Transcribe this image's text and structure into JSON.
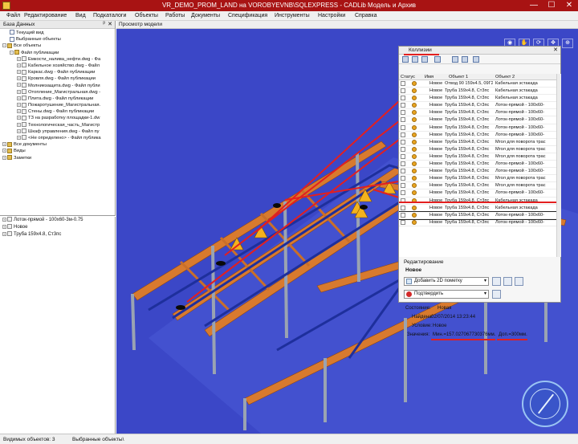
{
  "window": {
    "title": "VR_DEMO_PROM_LAND на VOROBYEVNB\\SQLEXPRESS - CADLib Модель и Архив",
    "min": "—",
    "max": "☐",
    "close": "✕"
  },
  "menu": [
    "Файл",
    "Редактирование",
    "Вид",
    "Подкаталоги",
    "Объекты",
    "Работы",
    "Документы",
    "Спецификация",
    "Инструменты",
    "Настройки",
    "Справка"
  ],
  "db_panel": {
    "title": "База Данных",
    "pin": "ᵖ",
    "close": "✕",
    "items": [
      {
        "label": "Текущий вид",
        "indent": 1,
        "icon": "doc"
      },
      {
        "label": "Выбранные объекты",
        "indent": 1,
        "icon": "doc"
      },
      {
        "label": "Все объекты",
        "indent": 0,
        "icon": "folder",
        "expander": "−"
      },
      {
        "label": "Файл публикации",
        "indent": 1,
        "icon": "folder",
        "expander": "−"
      },
      {
        "label": "Емкости_налива_нефти.dwg - Фа",
        "indent": 2,
        "icon": "file",
        "expander": "+"
      },
      {
        "label": "Кабельное хозяйство.dwg - Файл",
        "indent": 2,
        "icon": "file",
        "expander": "+"
      },
      {
        "label": "Каркас.dwg - Файл публикации",
        "indent": 2,
        "icon": "file",
        "expander": "+"
      },
      {
        "label": "Кровля.dwg - Файл публикации",
        "indent": 2,
        "icon": "file",
        "expander": "+"
      },
      {
        "label": "Молниезащита.dwg - Файл публи",
        "indent": 2,
        "icon": "file",
        "expander": "+"
      },
      {
        "label": "Отопление_Магистральная.dwg -",
        "indent": 2,
        "icon": "file",
        "expander": "+"
      },
      {
        "label": "Плита.dwg - Файл публикации",
        "indent": 2,
        "icon": "file",
        "expander": "+"
      },
      {
        "label": "Пожаротушение_Магистральная.",
        "indent": 2,
        "icon": "file",
        "expander": "+"
      },
      {
        "label": "Стены.dwg - Файл публикации",
        "indent": 2,
        "icon": "file",
        "expander": "+"
      },
      {
        "label": "ТЗ на разработку площадки-1.dw",
        "indent": 2,
        "icon": "file",
        "expander": "+"
      },
      {
        "label": "Технологическая_часть_Магистр",
        "indent": 2,
        "icon": "file",
        "expander": "+"
      },
      {
        "label": "Шкаф управления.dwg - Файл пу",
        "indent": 2,
        "icon": "file",
        "expander": "+"
      },
      {
        "label": "<Не определено> - Файл публика",
        "indent": 2,
        "icon": "file",
        "expander": "+"
      },
      {
        "label": "Все документы",
        "indent": 0,
        "icon": "folder",
        "expander": "+"
      },
      {
        "label": "Виды",
        "indent": 0,
        "icon": "folder",
        "expander": "+"
      },
      {
        "label": "Заметки",
        "indent": 0,
        "icon": "folder",
        "expander": "+"
      }
    ]
  },
  "lower_panel": {
    "items": [
      {
        "label": "Лоток-прямой - 100х60-3м-0.75",
        "indent": 0
      },
      {
        "label": "Новое",
        "indent": 0
      },
      {
        "label": "Труба 159х4.8, Ст3пс",
        "indent": 0
      }
    ]
  },
  "viewport": {
    "tab": "Просмотр модели",
    "nav_icons": [
      "eye-icon",
      "hand-icon",
      "orbit-icon",
      "pan-icon",
      "zoom-icon"
    ]
  },
  "collisions": {
    "title": "Коллизии",
    "close": "✕",
    "columns": [
      "Статус",
      "Имя",
      "Объект 1",
      "Объект 2"
    ],
    "rows": [
      {
        "status": "Новое",
        "name": "Новое",
        "obj1": "Отвод 90 159х4.5, 09Г2С",
        "obj2": "Кабельная эстакада"
      },
      {
        "status": "Новое",
        "name": "Новое",
        "obj1": "Труба 159х4.8, Ст3пс",
        "obj2": "Кабельная эстакада"
      },
      {
        "status": "Новое",
        "name": "Новое",
        "obj1": "Труба 159х4.8, Ст3пс",
        "obj2": "Кабельная эстакада"
      },
      {
        "status": "Новое",
        "name": "Новое",
        "obj1": "Труба 159х4.8, Ст3пс",
        "obj2": "Лоток-прямой - 100х60-"
      },
      {
        "status": "Новое",
        "name": "Новое",
        "obj1": "Труба 159х4.8, Ст3пс",
        "obj2": "Лоток-прямой - 100х60-"
      },
      {
        "status": "Новое",
        "name": "Новое",
        "obj1": "Труба 159х4.8, Ст3пс",
        "obj2": "Лоток-прямой - 100х60-"
      },
      {
        "status": "Новое",
        "name": "Новое",
        "obj1": "Труба 159х4.8, Ст3пс",
        "obj2": "Лоток-прямой - 100х60-"
      },
      {
        "status": "Новое",
        "name": "Новое",
        "obj1": "Труба 159х4.8, Ст3пс",
        "obj2": "Лоток-прямой - 100х60-"
      },
      {
        "status": "Новое",
        "name": "Новое",
        "obj1": "Труба 159х4.8, Ст3пс",
        "obj2": "Мгол для поворота трас"
      },
      {
        "status": "Новое",
        "name": "Новое",
        "obj1": "Труба 159х4.8, Ст3пс",
        "obj2": "Мгол для поворота трас"
      },
      {
        "status": "Новое",
        "name": "Новое",
        "obj1": "Труба 159х4.8, Ст3пс",
        "obj2": "Мгол для поворота трас"
      },
      {
        "status": "Новое",
        "name": "Новое",
        "obj1": "Труба 159х4.8, Ст3пс",
        "obj2": "Лоток-прямой - 100х60-"
      },
      {
        "status": "Новое",
        "name": "Новое",
        "obj1": "Труба 159х4.8, Ст3пс",
        "obj2": "Лоток-прямой - 100х60-"
      },
      {
        "status": "Новое",
        "name": "Новое",
        "obj1": "Труба 159х4.8, Ст3пс",
        "obj2": "Мгол для поворота трас"
      },
      {
        "status": "Новое",
        "name": "Новое",
        "obj1": "Труба 159х4.8, Ст3пс",
        "obj2": "Мгол для поворота трас"
      },
      {
        "status": "Новое",
        "name": "Новое",
        "obj1": "Труба 159х4.8, Ст3пс",
        "obj2": "Лоток-прямой - 100х60-"
      },
      {
        "status": "Новое",
        "name": "Новое",
        "obj1": "Труба 159х4.8, Ст3пс",
        "obj2": "Кабельная эстакада"
      },
      {
        "status": "Новое",
        "name": "Новое",
        "obj1": "Труба 159х4.8, Ст3пс",
        "obj2": "Кабельная эстакада"
      },
      {
        "status": "Новое",
        "name": "Новое",
        "obj1": "Труба 159х4.8, Ст3пс",
        "obj2": "Лоток-прямой - 100х60-"
      },
      {
        "status": "Новое",
        "name": "Новое",
        "obj1": "Труба 159х4.8, Ст3пс",
        "obj2": "Лоток-прямой - 100х60-"
      }
    ],
    "selected_row": 18,
    "edit": {
      "section_label": "Редактирование",
      "name": "Новое",
      "add_note": "Добавить 2D пометку",
      "confirm": "Подтвердить",
      "state_label": "Состояние:",
      "state_value": "Новая",
      "found_label": "Найдена:",
      "found_value": "02/07/2014 13:23:44",
      "condition_label": "Условие:",
      "condition_value": "Новое",
      "values_label": "Значения:",
      "min_value": "Мин.=157.027067730376мм.",
      "tol_value": "Доп.=300мм."
    }
  },
  "statusbar": {
    "visible": "Видимых объектов: 3",
    "selected": "Выбранные объекты\\"
  },
  "colors": {
    "title_bar": "#a81313",
    "scene_bg": "#3b47c7",
    "tray": "#d87a2e",
    "highlight": "#e31f1f"
  }
}
